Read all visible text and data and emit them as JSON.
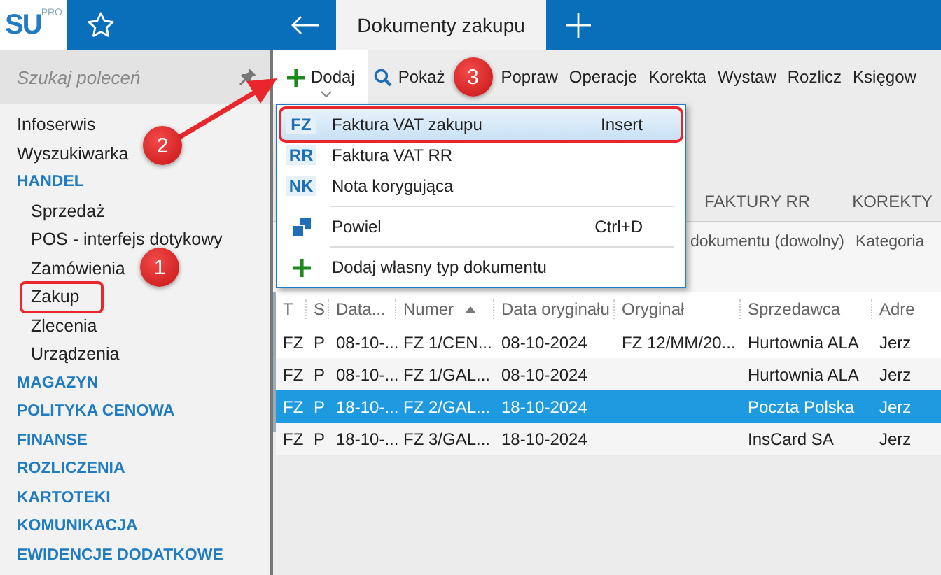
{
  "logo": {
    "text": "SU",
    "sup": "PRO"
  },
  "tab": {
    "title": "Dokumenty zakupu"
  },
  "search": {
    "placeholder": "Szukaj poleceń"
  },
  "sidebar": {
    "items": [
      {
        "label": "Infoserwis",
        "kind": "link"
      },
      {
        "label": "Wyszukiwarka",
        "kind": "link"
      },
      {
        "label": "HANDEL",
        "kind": "section",
        "children": [
          {
            "label": "Sprzedaż"
          },
          {
            "label": "POS - interfejs dotykowy"
          },
          {
            "label": "Zamówienia"
          },
          {
            "label": "Zakup"
          },
          {
            "label": "Zlecenia"
          },
          {
            "label": "Urządzenia"
          }
        ]
      },
      {
        "label": "MAGAZYN",
        "kind": "section"
      },
      {
        "label": "POLITYKA CENOWA",
        "kind": "section"
      },
      {
        "label": "FINANSE",
        "kind": "section"
      },
      {
        "label": "ROZLICZENIA",
        "kind": "section"
      },
      {
        "label": "KARTOTEKI",
        "kind": "section"
      },
      {
        "label": "KOMUNIKACJA",
        "kind": "section"
      },
      {
        "label": "EWIDENCJE DODATKOWE",
        "kind": "section"
      }
    ]
  },
  "toolbar": [
    {
      "label": "Dodaj",
      "kind": "add"
    },
    {
      "label": "Pokaż",
      "kind": "show"
    },
    {
      "label": "Popraw",
      "kind": "plain"
    },
    {
      "label": "Operacje",
      "kind": "plain"
    },
    {
      "label": "Korekta",
      "kind": "plain"
    },
    {
      "label": "Wystaw",
      "kind": "plain"
    },
    {
      "label": "Rozlicz",
      "kind": "plain"
    },
    {
      "label": "Księgow",
      "kind": "plain"
    }
  ],
  "doc_tabs": [
    "FAKTURY RR",
    "KOREKTY"
  ],
  "filters": [
    "dokumentu (dowolny)",
    "Kategoria"
  ],
  "menu": [
    {
      "kind": "doc",
      "code": "FZ",
      "label": "Faktura VAT zakupu",
      "shortcut": "Insert",
      "selected": true
    },
    {
      "kind": "doc",
      "code": "RR",
      "label": "Faktura VAT RR",
      "selected": false
    },
    {
      "kind": "doc",
      "code": "NK",
      "label": "Nota korygująca",
      "selected": false
    },
    {
      "kind": "separator"
    },
    {
      "kind": "copy",
      "label": "Powiel",
      "shortcut": "Ctrl+D",
      "selected": false
    },
    {
      "kind": "separator"
    },
    {
      "kind": "add",
      "label": "Dodaj własny typ dokumentu",
      "selected": false
    }
  ],
  "table": {
    "columns": [
      {
        "label": "T"
      },
      {
        "label": "S"
      },
      {
        "label": "Data..."
      },
      {
        "label": "Numer",
        "sorted_ascending": true
      },
      {
        "label": "Data oryginału"
      },
      {
        "label": "Oryginał"
      },
      {
        "label": "Sprzedawca"
      },
      {
        "label": "Adre"
      }
    ],
    "rows": [
      {
        "cells": [
          "FZ",
          "P",
          "08-10-...",
          "FZ 1/CEN...",
          "08-10-2024",
          "FZ 12/MM/20...",
          "Hurtownia ALA",
          "Jerz"
        ],
        "selected": false
      },
      {
        "cells": [
          "FZ",
          "P",
          "08-10-...",
          "FZ 1/GAL...",
          "08-10-2024",
          "",
          "Hurtownia ALA",
          "Jerz"
        ],
        "selected": false
      },
      {
        "cells": [
          "FZ",
          "P",
          "18-10-...",
          "FZ 2/GAL...",
          "18-10-2024",
          "",
          "Poczta Polska",
          "Jerz"
        ],
        "selected": true
      },
      {
        "cells": [
          "FZ",
          "P",
          "18-10-...",
          "FZ 3/GAL...",
          "18-10-2024",
          "",
          "InsCard SA",
          "Jerz"
        ],
        "selected": false
      }
    ]
  },
  "callouts": [
    "1",
    "2",
    "3"
  ]
}
